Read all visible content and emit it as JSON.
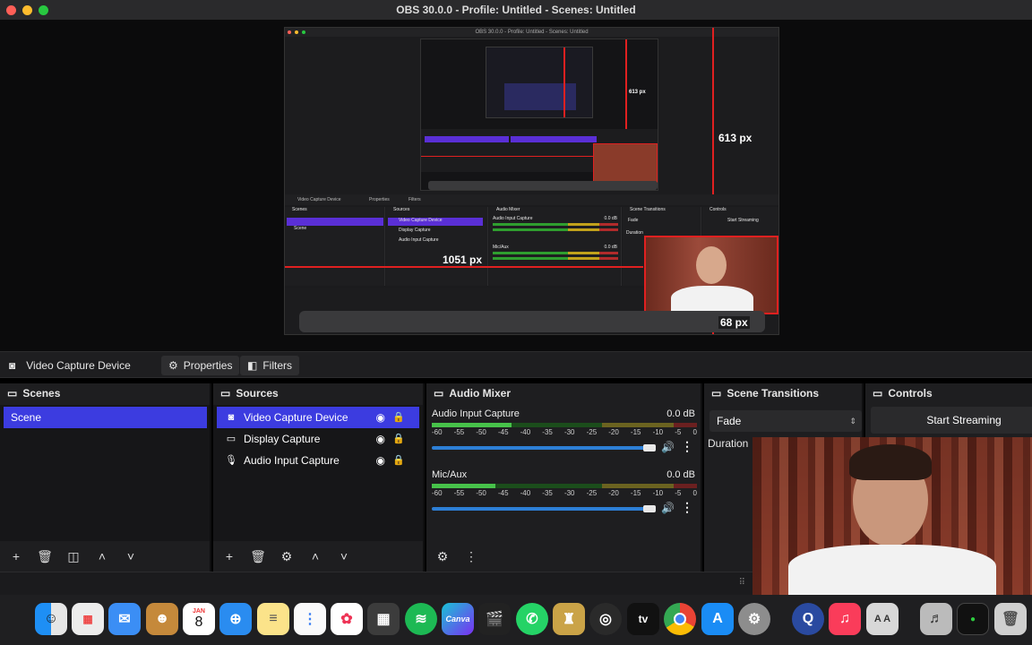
{
  "window": {
    "title": "OBS 30.0.0 - Profile: Untitled - Scenes: Untitled"
  },
  "preview": {
    "nested_title": "OBS 30.0.0 - Profile: Untitled - Scenes: Untitled",
    "annotations": {
      "height_label": "613 px",
      "width_label": "1051 px",
      "small_label": "68 px",
      "nested_height_label": "613 px"
    },
    "mini_context": {
      "source": "Video Capture Device",
      "properties": "Properties",
      "filters": "Filters"
    },
    "mini_panels": {
      "scenes": "Scenes",
      "sources": "Sources",
      "mixer": "Audio Mixer",
      "transitions": "Scene Transitions",
      "controls": "Controls"
    },
    "mini_scene": "Scene",
    "mini_sources": [
      "Video Capture Device",
      "Display Capture",
      "Audio Input Capture"
    ],
    "mini_mixer": [
      "Audio Input Capture",
      "Mic/Aux"
    ],
    "mini_mixer_db": "0.0 dB",
    "mini_transition": "Fade",
    "mini_duration": "Duration",
    "mini_start": "Start Streaming"
  },
  "context_bar": {
    "source_name": "Video Capture Device",
    "properties_label": "Properties",
    "filters_label": "Filters"
  },
  "scenes": {
    "title": "Scenes",
    "items": [
      "Scene"
    ],
    "selected": 0
  },
  "sources": {
    "title": "Sources",
    "items": [
      {
        "label": "Video Capture Device",
        "icon": "camera-icon",
        "selected": true
      },
      {
        "label": "Display Capture",
        "icon": "monitor-icon",
        "selected": false
      },
      {
        "label": "Audio Input Capture",
        "icon": "microphone-icon",
        "selected": false
      }
    ]
  },
  "mixer": {
    "title": "Audio Mixer",
    "channels": [
      {
        "name": "Audio Input Capture",
        "db": "0.0 dB",
        "level": 0.3,
        "volume": 1.0
      },
      {
        "name": "Mic/Aux",
        "db": "0.0 dB",
        "level": 0.24,
        "volume": 1.0
      }
    ],
    "scale": [
      "-60",
      "-55",
      "-50",
      "-45",
      "-40",
      "-35",
      "-30",
      "-25",
      "-20",
      "-15",
      "-10",
      "-5",
      "0"
    ]
  },
  "transitions": {
    "title": "Scene Transitions",
    "selected": "Fade",
    "duration_label": "Duration"
  },
  "controls": {
    "title": "Controls",
    "start_streaming": "Start Streaming"
  },
  "dock": {
    "calendar_month": "JAN",
    "calendar_day": "8",
    "canva_label": "Canva",
    "appletv_label": "tv",
    "fontbook_label": "A A",
    "apps": [
      "Finder",
      "Launchpad",
      "Mail",
      "Contacts",
      "Calendar",
      "Safari",
      "Notes",
      "Reminders",
      "Photos",
      "Calculator",
      "Spotify",
      "Canva",
      "Final Cut Pro",
      "WhatsApp",
      "Cinema",
      "OBS",
      "Apple TV",
      "Chrome",
      "App Store",
      "System Settings",
      "QuickTime",
      "Music",
      "Font Book",
      "Audio MIDI",
      "Terminal",
      "Trash"
    ]
  },
  "colors": {
    "accent": "#3c3ce0",
    "annotation_red": "#e02020",
    "meter_green": "#47c24a",
    "volume_blue": "#2d7fd6"
  }
}
